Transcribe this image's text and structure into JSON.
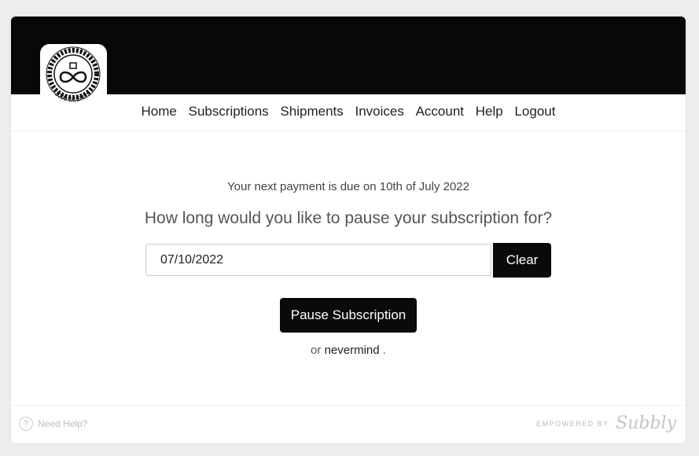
{
  "logo": {
    "text": "1000 SCENTS"
  },
  "nav": {
    "items": [
      "Home",
      "Subscriptions",
      "Shipments",
      "Invoices",
      "Account",
      "Help",
      "Logout"
    ]
  },
  "main": {
    "due_text": "Your next payment is due on 10th of July 2022",
    "question": "How long would you like to pause your subscription for?",
    "date_value": "07/10/2022",
    "clear_label": "Clear",
    "pause_label": "Pause Subscription",
    "or_text": "or",
    "nevermind_label": "nevermind",
    "period": "."
  },
  "footer": {
    "help_label": "Need Help?",
    "help_icon": "question-bubble-icon",
    "powered_label": "EMPOWERED BY:",
    "brand": "Subbly"
  },
  "colors": {
    "header_bg": "#080808",
    "button_bg": "#0a0a0a",
    "page_bg": "#eceeee"
  }
}
